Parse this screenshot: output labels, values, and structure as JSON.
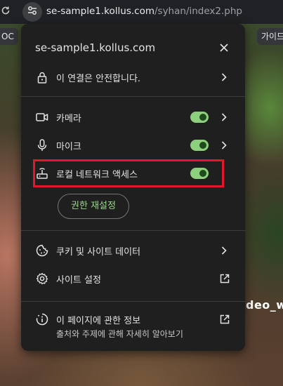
{
  "browser": {
    "url_host": "se-sample1.kollus.com",
    "url_path": "/syhan/index2.php",
    "bookmark_left": "OC",
    "bookmark_right": "가이드"
  },
  "background": {
    "watermark_text": "deo_wa"
  },
  "popup": {
    "title": "se-sample1.kollus.com",
    "connection_label": "이 연결은 안전합니다.",
    "permissions": [
      {
        "label": "카메라",
        "icon": "camera-icon",
        "enabled": true
      },
      {
        "label": "마이크",
        "icon": "microphone-icon",
        "enabled": true
      },
      {
        "label": "로컬 네트워크 액세스",
        "icon": "local-network-icon",
        "enabled": true
      }
    ],
    "reset_button_label": "권한 재설정",
    "cookies_label": "쿠키 및 사이트 데이터",
    "site_settings_label": "사이트 설정",
    "page_info_label": "이 페이지에 관한 정보",
    "page_info_sublabel": "출처와 주제에 관해 자세히 알아보기"
  },
  "colors": {
    "toggle_on": "#8ecf7f",
    "highlight_border": "#e5162b",
    "panel_bg": "#1f1f1f"
  }
}
